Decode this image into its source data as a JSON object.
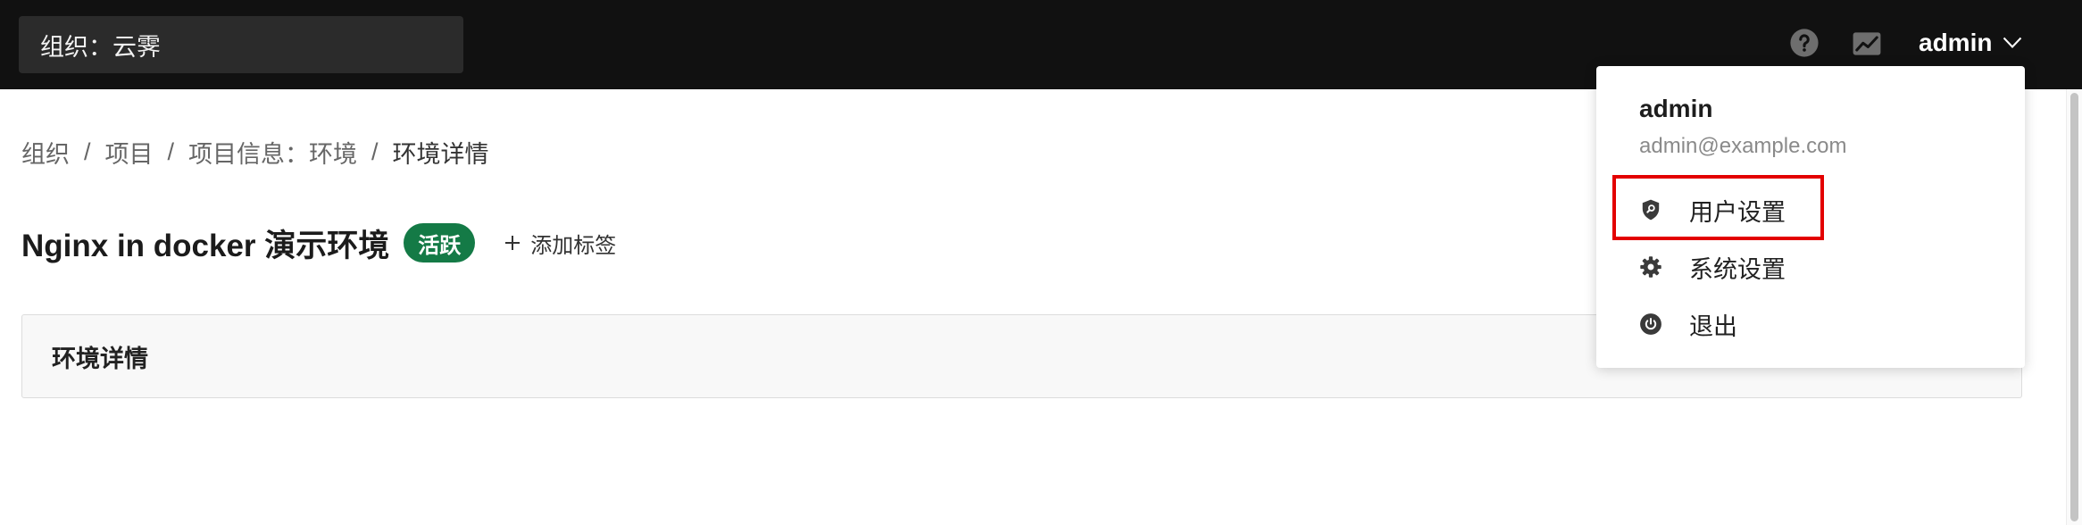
{
  "header": {
    "org_selector": "组织：云霁",
    "user_name": "admin",
    "icons": [
      "help-circle-icon",
      "chart-icon",
      "chevron-down-icon"
    ]
  },
  "user_menu": {
    "name": "admin",
    "email": "admin@example.com",
    "items": [
      {
        "label": "用户设置",
        "icon": "shield-search-icon",
        "highlighted": true
      },
      {
        "label": "系统设置",
        "icon": "gear-icon",
        "highlighted": false
      },
      {
        "label": "退出",
        "icon": "power-icon",
        "highlighted": false
      }
    ]
  },
  "breadcrumb": {
    "separator": "/",
    "items": [
      "组织",
      "项目",
      "项目信息：环境",
      "环境详情"
    ]
  },
  "page": {
    "title": "Nginx in docker 演示环境",
    "status_badge": "活跃",
    "add_tag_label": "添加标签",
    "add_tag_icon": "plus-icon"
  },
  "panel": {
    "title": "环境详情"
  },
  "colors": {
    "header_bg": "#111111",
    "status_active": "#147a46",
    "highlight_border": "#e30000"
  }
}
